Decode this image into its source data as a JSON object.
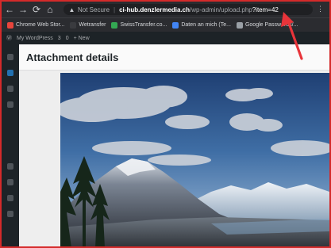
{
  "browser": {
    "url_security": "Not Secure",
    "url_host": "ci-hub.denzlermedia.ch",
    "url_path": "/wp-admin/upload.php",
    "url_query": "?item=42",
    "bookmarks": [
      {
        "label": "Chrome Web Stor...",
        "color": "#e8453c"
      },
      {
        "label": "Wetransfer",
        "color": "#2b2c30"
      },
      {
        "label": "SwissTransfer.co...",
        "color": "#34a853"
      },
      {
        "label": "Daten an mich (Te...",
        "color": "#4285f4"
      },
      {
        "label": "Google Passwords/...",
        "color": "#9aa0a6"
      }
    ]
  },
  "adminbar": {
    "site_label": "My WordPress",
    "comments_count": "3",
    "updates_count": "0",
    "new_label": "+ New"
  },
  "modal": {
    "title": "Attachment details"
  },
  "colors": {
    "annotation_arrow": "#e8343a",
    "frame_border": "#d52a2a"
  }
}
